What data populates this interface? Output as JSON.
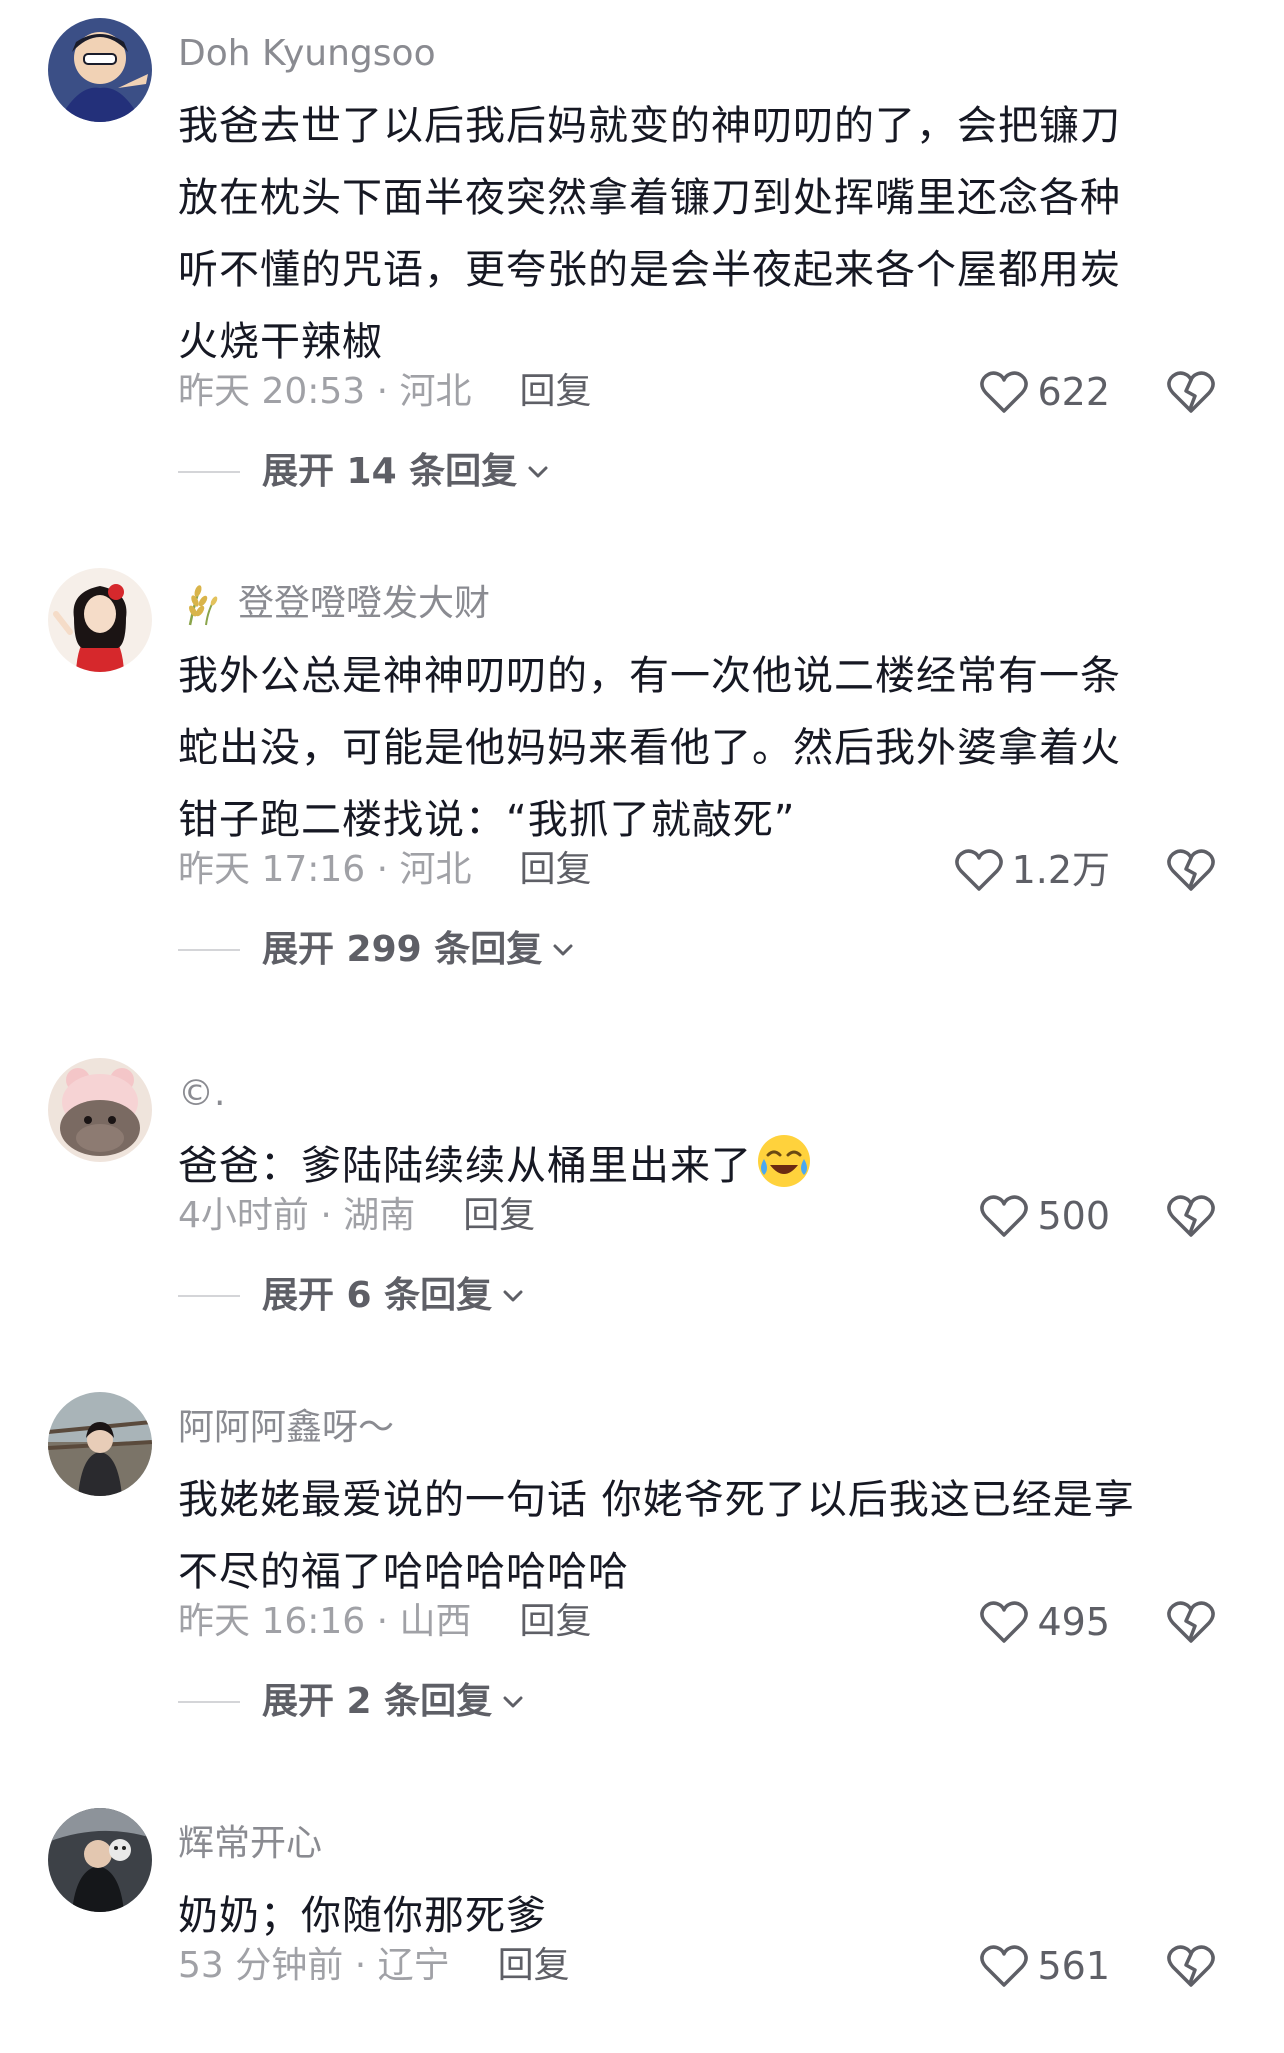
{
  "comments": [
    {
      "username": "Doh Kyungsoo",
      "lines": [
        "我爸去世了以后我后妈就变的神叨叨的了，会把镰刀",
        "放在枕头下面半夜突然拿着镰刀到处挥嘴里还念各种",
        "听不懂的咒语，更夸张的是会半夜起来各个屋都用炭",
        "火烧干辣椒"
      ],
      "meta": "昨天 20:53 · 河北",
      "reply_label": "回复",
      "likes": "622",
      "expand": "展开 14 条回复"
    },
    {
      "username": "登登噔噔发大财",
      "lines": [
        "我外公总是神神叨叨的，有一次他说二楼经常有一条",
        "蛇出没，可能是他妈妈来看他了。然后我外婆拿着火",
        "钳子跑二楼找说：“我抓了就敲死”"
      ],
      "meta": "昨天 17:16 · 河北",
      "reply_label": "回复",
      "likes": "1.2万",
      "expand": "展开 299 条回复"
    },
    {
      "username": "©.",
      "lines": [
        "爸爸：爹陆陆续续从桶里出来了"
      ],
      "meta": "4小时前 · 湖南",
      "reply_label": "回复",
      "likes": "500",
      "expand": "展开 6 条回复"
    },
    {
      "username": "阿阿阿鑫呀～",
      "lines": [
        "我姥姥最爱说的一句话 你姥爷死了以后我这已经是享",
        "不尽的福了哈哈哈哈哈哈"
      ],
      "meta": "昨天 16:16 · 山西",
      "reply_label": "回复",
      "likes": "495",
      "expand": "展开 2 条回复"
    },
    {
      "username": "辉常开心",
      "lines": [
        "奶奶；你随你那死爹"
      ],
      "meta": "53 分钟前 · 辽宁",
      "reply_label": "回复",
      "likes": "561"
    }
  ],
  "icons": {
    "like": "heart-outline-icon",
    "dislike": "broken-heart-icon",
    "expand": "chevron-down-icon",
    "badge": "wheat-icon",
    "emoji": "crying-laughing-emoji"
  },
  "colors": {
    "username": "#8a8b91",
    "text": "#161823",
    "meta": "#a0a1a6",
    "action": "#5e5f66"
  }
}
